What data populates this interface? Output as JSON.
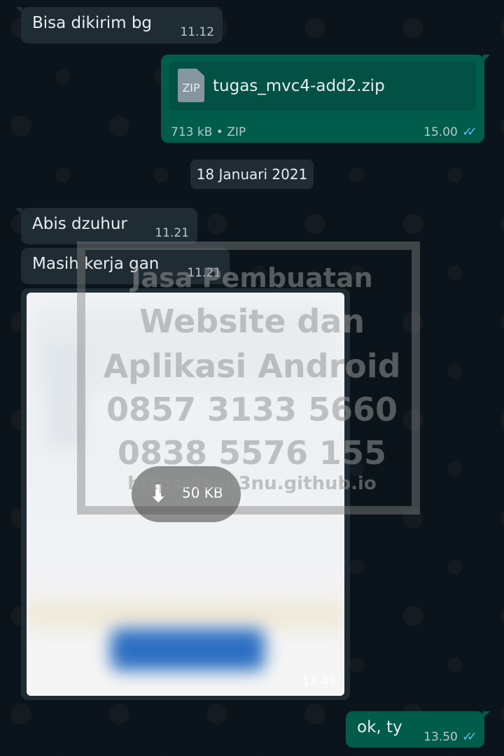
{
  "messages": [
    {
      "dir": "in",
      "text": "Bisa dikirim bg",
      "time": "11.12"
    },
    {
      "dir": "out",
      "type": "file",
      "file": {
        "icon": "ZIP",
        "name": "tugas_mvc4-add2.zip",
        "meta": "713 kB • ZIP"
      },
      "time": "15.00",
      "status": "read"
    },
    {
      "dir": "in",
      "text": "Abis dzuhur",
      "time": "11.21"
    },
    {
      "dir": "in",
      "text": "Masih kerja gan",
      "time": "11.21"
    },
    {
      "dir": "in",
      "type": "image",
      "download_size": "50 KB",
      "time": "13.45"
    },
    {
      "dir": "out",
      "text": "ok, ty",
      "time": "13.50",
      "status": "read"
    }
  ],
  "date_separator": "18 Januari 2021",
  "watermark": {
    "lines": [
      "Jasa Pembuatan",
      "Website dan",
      "Aplikasi Android",
      "0857 3133 5660",
      "0838 5576 155",
      "https://san3nu.github.io"
    ]
  },
  "icons": {
    "read": "double-check-icon",
    "download": "download-arrow-icon",
    "file": "zip-file-icon"
  },
  "colors": {
    "incoming": "#1f2c34",
    "outgoing": "#005c4b",
    "background": "#0b141a",
    "read_tick": "#53bdeb"
  }
}
